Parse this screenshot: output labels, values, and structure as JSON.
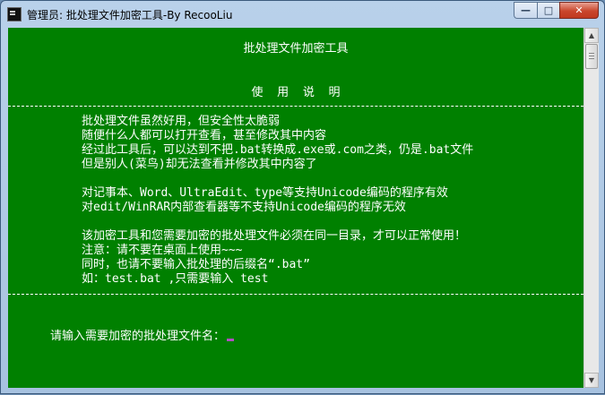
{
  "window": {
    "title": "管理员:  批处理文件加密工具-By RecooLiu",
    "controls": {
      "minimize": "—",
      "maximize": "□",
      "close": "✕"
    }
  },
  "console": {
    "heading": "批处理文件加密工具",
    "subheading": "使  用  说  明",
    "separator": "------------------------------------------------------------------------------",
    "instructions": [
      "批处理文件虽然好用，但安全性太脆弱",
      "随便什么人都可以打开查看，甚至修改其中内容",
      "经过此工具后，可以达到不把.bat转换成.exe或.com之类，仍是.bat文件",
      "但是别人(菜鸟)却无法查看并修改其中内容了",
      "",
      "对记事本、Word、UltraEdit、type等支持Unicode编码的程序有效",
      "对edit/WinRAR内部查看器等不支持Unicode编码的程序无效",
      "",
      "该加密工具和您需要加密的批处理文件必须在同一目录，才可以正常使用！",
      "注意：请不要在桌面上使用~~~",
      "同时，也请不要输入批处理的后缀名“.bat”",
      "如：test.bat ,只需要输入 test"
    ],
    "prompt": "请输入需要加密的批处理文件名："
  },
  "colors": {
    "console_bg": "#008000",
    "console_fg": "#ffffff",
    "cursor": "#b04fc3"
  },
  "icons": {
    "app": "console-icon",
    "scroll_up": "arrow-up-icon",
    "scroll_down": "arrow-down-icon"
  }
}
